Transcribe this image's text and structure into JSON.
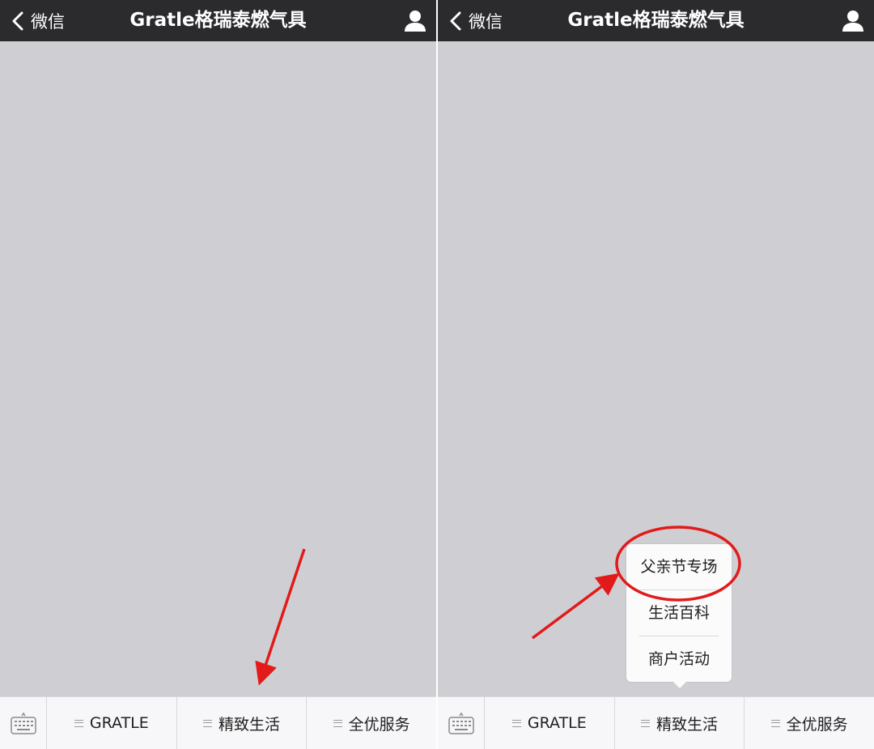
{
  "screens": [
    {
      "back_label": "微信",
      "title": "Gratle格瑞泰燃气具",
      "menu": [
        "GRATLE",
        "精致生活",
        "全优服务"
      ]
    },
    {
      "back_label": "微信",
      "title": "Gratle格瑞泰燃气具",
      "menu": [
        "GRATLE",
        "精致生活",
        "全优服务"
      ],
      "submenu": [
        "父亲节专场",
        "生活百科",
        "商户活动"
      ]
    }
  ],
  "icons": [
    "back-chevron-icon",
    "profile-icon",
    "keyboard-icon",
    "menu-lines-icon"
  ],
  "colors": {
    "header_bg": "#2b2b2e",
    "chat_bg": "#cfcfd3",
    "menubar_bg": "#f7f7f9",
    "annotation_red": "#e21a1a"
  }
}
